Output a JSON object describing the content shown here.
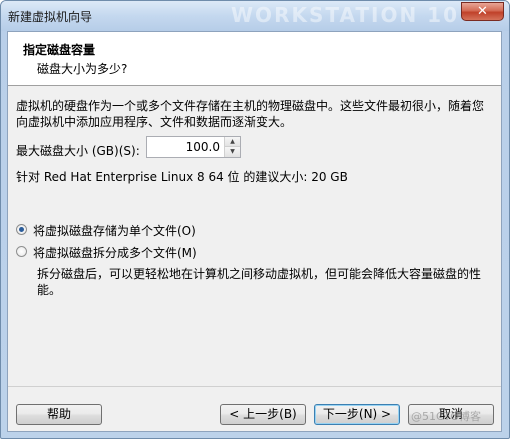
{
  "window": {
    "title": "新建虚拟机向导",
    "title_watermark": "WORKSTATION 10",
    "close_glyph": "✕"
  },
  "header": {
    "title": "指定磁盘容量",
    "subtitle": "磁盘大小为多少?"
  },
  "body": {
    "description_line1": "虚拟机的硬盘作为一个或多个文件存储在主机的物理磁盘中。这些文件最初很小，随着您",
    "description_line2": "向虚拟机中添加应用程序、文件和数据而逐渐变大。",
    "max_size_label": "最大磁盘大小 (GB)(S):",
    "max_size_value": "100.0",
    "recommended_text": "针对 Red Hat Enterprise Linux 8 64 位 的建议大小: 20 GB"
  },
  "options": {
    "single_file_label": "将虚拟磁盘存储为单个文件(O)",
    "single_file_checked": true,
    "multi_file_label": "将虚拟磁盘拆分成多个文件(M)",
    "multi_file_checked": false,
    "split_description_line1": "拆分磁盘后，可以更轻松地在计算机之间移动虚拟机，但可能会降低大容量磁盘的性",
    "split_description_line2": "能。"
  },
  "footer": {
    "help_label": "帮助",
    "back_label": "< 上一步(B)",
    "next_label": "下一步(N) >",
    "cancel_label": "取消",
    "watermark": "@51CTO博客"
  },
  "colors": {
    "titlebar_bg": "#c4d8ef",
    "client_bg": "#f0f0f0",
    "header_bg": "#ffffff",
    "close_button": "#c0412a",
    "radio_dot": "#2a5c9a",
    "default_button_border": "#3c7fb1"
  },
  "icons": {
    "spin_up": "▲",
    "spin_down": "▼"
  }
}
